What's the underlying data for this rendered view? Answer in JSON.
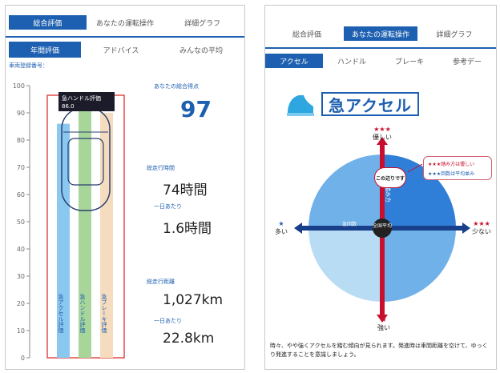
{
  "left": {
    "tabs_top": [
      "総合評価",
      "あなたの運転操作",
      "詳細グラフ"
    ],
    "tabs_sub": [
      "年間評価",
      "アドバイス",
      "みんなの平均"
    ],
    "regnum_label": "車両登録番号：",
    "gauge": {
      "y_ticks": [
        "100",
        "90",
        "80",
        "70",
        "60",
        "50",
        "40",
        "30",
        "20",
        "10",
        "0"
      ],
      "bars": [
        {
          "label": "急ハンドル評価",
          "value": 86,
          "color": "#8ac8ef"
        },
        {
          "label": "急アクセル評価",
          "value": 97,
          "color": "#a8d69a"
        },
        {
          "label": "急ブレーキ評価",
          "value": 90,
          "color": "#f6dcbf"
        }
      ],
      "overlay_label": "急ハンドル評価",
      "overlay_value": "86.0",
      "bar_text": [
        "急アクセル評価",
        "急ハンドル評価",
        "急ブレーキ評価"
      ]
    },
    "score_label": "あなたの総合得点",
    "score_value": "97",
    "time_label": "総走行時間",
    "time_value": "74時間",
    "daytime_label": "一日あたり",
    "daytime_value": "1.6時間",
    "dist_label": "総走行距離",
    "dist_value": "1,027km",
    "daydist_label": "一日あたり",
    "daydist_value": "22.8km"
  },
  "right": {
    "tabs_top": [
      "総合評価",
      "あなたの運転操作",
      "詳細グラフ"
    ],
    "tabs_sub": [
      "アクセル",
      "ハンドル",
      "ブレーキ",
      "参考デー"
    ],
    "title": "急アクセル",
    "axis_top": "優しい",
    "axis_bottom": "強い",
    "axis_left": "多い",
    "axis_right": "少ない",
    "stars_top": "★★★",
    "stars_bottom": "★",
    "stars_left": "★",
    "stars_right": "★★★",
    "axis_label_strength": "踏み方",
    "axis_label_frequency": "急回数",
    "center_label": "全国平均",
    "bubble_label": "この辺りです",
    "legend_line1": "★★★踏み方は優しい",
    "legend_line2": "★★★回数は平均並み",
    "advice": "時々、やや強くアクセルを踏む傾向が見られます。発進時は車間距離を空けて、ゆっくり発進することを意識しましょう。",
    "colors": {
      "accent": "#1d5fb0",
      "red_axis": "#c8102e",
      "circle_light": "#b9dcf5",
      "circle_mid": "#6fb1e8",
      "circle_dark": "#2f7ed8"
    }
  }
}
